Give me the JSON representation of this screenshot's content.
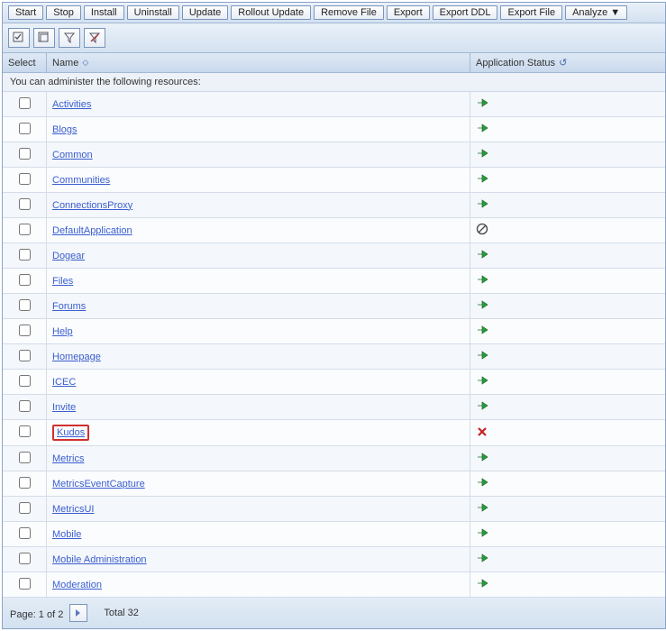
{
  "toolbar": {
    "start": "Start",
    "stop": "Stop",
    "install": "Install",
    "uninstall": "Uninstall",
    "update": "Update",
    "rollout_update": "Rollout Update",
    "remove_file": "Remove File",
    "export": "Export",
    "export_ddl": "Export DDL",
    "export_file": "Export File",
    "analyze": "Analyze ▼"
  },
  "columns": {
    "select": "Select",
    "name": "Name",
    "status": "Application Status"
  },
  "info_text": "You can administer the following resources:",
  "rows": [
    {
      "name": "Activities",
      "status": "running",
      "highlighted": false
    },
    {
      "name": "Blogs",
      "status": "running",
      "highlighted": false
    },
    {
      "name": "Common",
      "status": "running",
      "highlighted": false
    },
    {
      "name": "Communities",
      "status": "running",
      "highlighted": false
    },
    {
      "name": "ConnectionsProxy",
      "status": "running",
      "highlighted": false
    },
    {
      "name": "DefaultApplication",
      "status": "unavailable",
      "highlighted": false
    },
    {
      "name": "Dogear",
      "status": "running",
      "highlighted": false
    },
    {
      "name": "Files",
      "status": "running",
      "highlighted": false
    },
    {
      "name": "Forums",
      "status": "running",
      "highlighted": false
    },
    {
      "name": "Help",
      "status": "running",
      "highlighted": false
    },
    {
      "name": "Homepage",
      "status": "running",
      "highlighted": false
    },
    {
      "name": "ICEC",
      "status": "running",
      "highlighted": false
    },
    {
      "name": "Invite",
      "status": "running",
      "highlighted": false
    },
    {
      "name": "Kudos",
      "status": "stopped",
      "highlighted": true
    },
    {
      "name": "Metrics",
      "status": "running",
      "highlighted": false
    },
    {
      "name": "MetricsEventCapture",
      "status": "running",
      "highlighted": false
    },
    {
      "name": "MetricsUI",
      "status": "running",
      "highlighted": false
    },
    {
      "name": "Mobile",
      "status": "running",
      "highlighted": false
    },
    {
      "name": "Mobile Administration",
      "status": "running",
      "highlighted": false
    },
    {
      "name": "Moderation",
      "status": "running",
      "highlighted": false
    }
  ],
  "footer": {
    "page_label": "Page: 1 of 2",
    "total_label": "Total 32"
  }
}
